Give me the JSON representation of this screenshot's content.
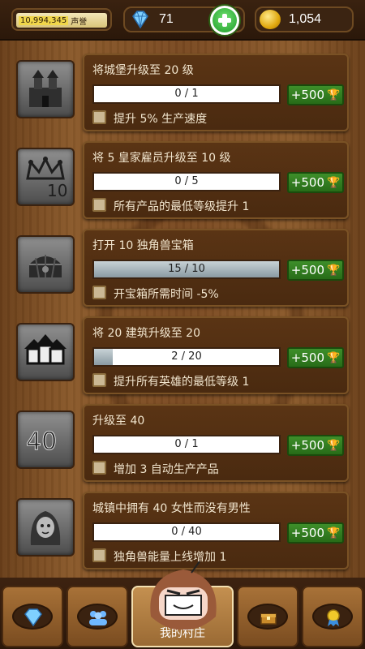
{
  "header": {
    "reputation_value": "10,994,345",
    "reputation_label": "声誉",
    "gems": "71",
    "coins": "1,054"
  },
  "tasks": [
    {
      "title": "将城堡升级至 20 级",
      "progress_text": "0 / 1",
      "progress": 0.0,
      "reward": "+500",
      "bonus": "提升 5% 生产速度",
      "icon": "castle-icon"
    },
    {
      "title": "将 5 皇家雇员升级至 10 级",
      "progress_text": "0 / 5",
      "progress": 0.0,
      "reward": "+500",
      "bonus": "所有产品的最低等级提升 1",
      "icon": "crown-10-icon"
    },
    {
      "title": "打开 10 独角兽宝箱",
      "progress_text": "15 / 10",
      "progress": 1.0,
      "reward": "+500",
      "bonus": "开宝箱所需时间 -5%",
      "icon": "chest-icon"
    },
    {
      "title": "将 20 建筑升级至 20",
      "progress_text": "2 / 20",
      "progress": 0.1,
      "reward": "+500",
      "bonus": "提升所有英雄的最低等级 1",
      "icon": "buildings-icon"
    },
    {
      "title": "升级至 40",
      "progress_text": "0 / 1",
      "progress": 0.0,
      "reward": "+500",
      "bonus": "增加 3 自动生产产品",
      "icon": "level-40-icon"
    },
    {
      "title": "城镇中拥有 40 女性而没有男性",
      "progress_text": "0 / 40",
      "progress": 0.0,
      "reward": "+500",
      "bonus": "独角兽能量上线增加 1",
      "icon": "woman-portrait-icon"
    }
  ],
  "icon_badges": {
    "crown_number": "10",
    "level_number": "40"
  },
  "bottom_nav": {
    "items": [
      "gem-icon",
      "people-icon",
      "village",
      "chest-icon",
      "medal-icon"
    ],
    "active_label": "我的村庄"
  },
  "colors": {
    "reward_green": "#3e8f2a",
    "card_brown": "#5a3414",
    "accent_gold": "#f0c82a"
  }
}
